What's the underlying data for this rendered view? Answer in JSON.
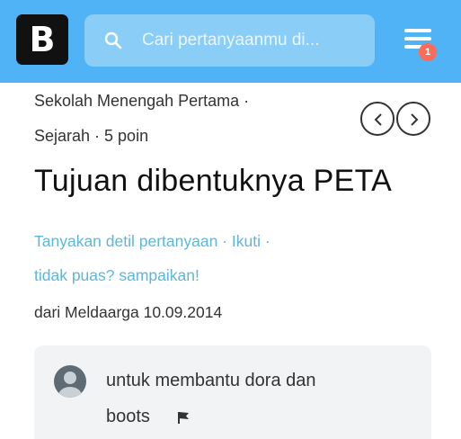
{
  "header": {
    "logo_letter": "B",
    "search_placeholder": "Cari pertanyaanmu di...",
    "menu_badge": "1"
  },
  "question": {
    "level": "Sekolah Menengah Pertama ·",
    "subject_points": "Sejarah · 5 poin",
    "title": "Tujuan dibentuknya PETA",
    "link_details": "Tanyakan detil pertanyaan",
    "link_follow": "Ikuti",
    "link_report": "tidak puas? sampaikan!",
    "author_line": "dari Meldaarga 10.09.2014"
  },
  "answer": {
    "line1": "untuk membantu dora dan",
    "line2": "boots"
  },
  "colors": {
    "topbar": "#4fb3f6",
    "search_bg": "#8acef8",
    "link": "#5cb7d9",
    "badge": "#ff6b59",
    "card_bg": "#f1f3f5"
  },
  "icons": {
    "search": "search-icon",
    "menu": "hamburger-menu-icon",
    "prev": "chevron-left-icon",
    "next": "chevron-right-icon",
    "avatar": "user-avatar-icon",
    "flag": "flag-icon"
  }
}
